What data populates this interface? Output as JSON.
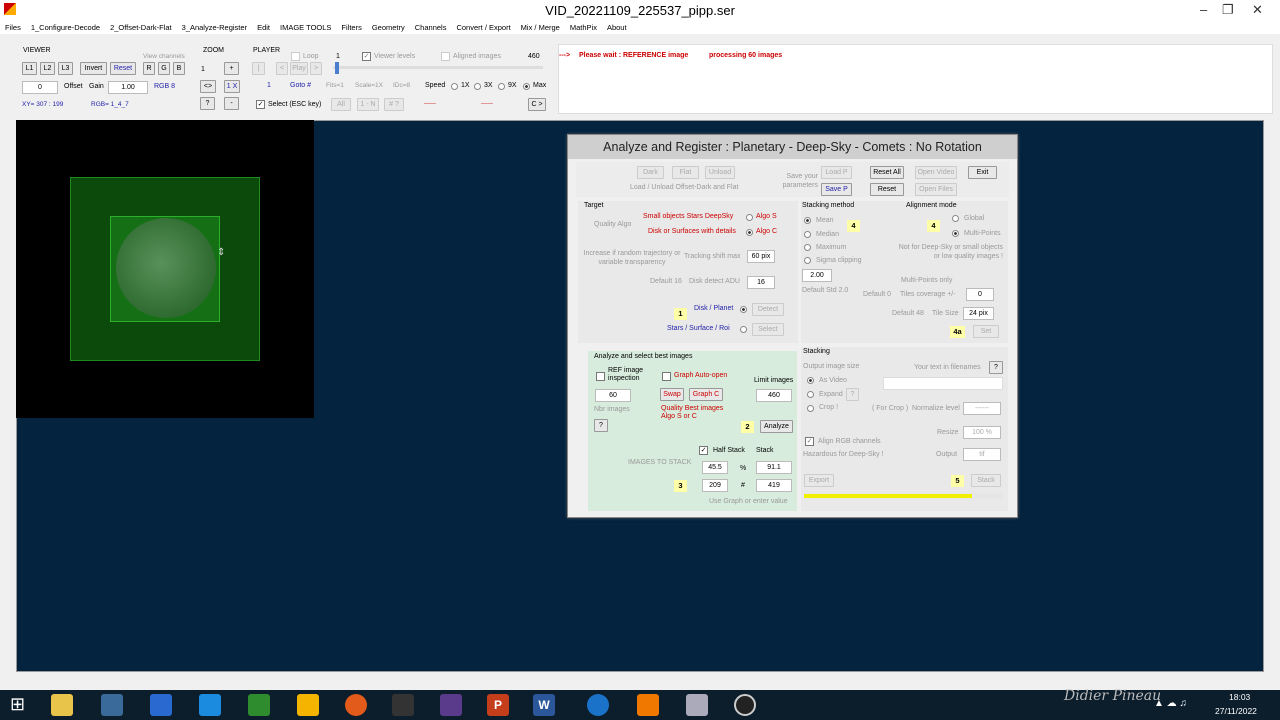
{
  "window": {
    "title": "VID_20221109_225537_pipp.ser"
  },
  "menu": [
    "Files",
    "1_Configure-Decode",
    "2_Offset-Dark-Flat",
    "3_Analyze-Register",
    "Edit",
    "IMAGE TOOLS",
    "Filters",
    "Geometry",
    "Channels",
    "Convert / Export",
    "Mix / Merge",
    "MathPix",
    "About"
  ],
  "viewer": {
    "label": "VIEWER",
    "view_channels": "View channels",
    "l1": "L1",
    "l2": "L2",
    "l3": "L3",
    "invert": "Invert",
    "reset": "Reset",
    "r": "R",
    "g": "G",
    "b": "B",
    "offset_value": "0",
    "offset": "Offset",
    "gain": "Gain",
    "gain_value": "1.00",
    "rgb": "RGB 8",
    "xy": "XY= 307 : 199",
    "rgbv": "RGB= 1_4_7"
  },
  "zoom": {
    "label": "ZOOM",
    "value": "1",
    "plus": "+",
    "swap": "<>",
    "one": "1 X",
    "q": "?",
    "minus": "-"
  },
  "player": {
    "label": "PLAYER",
    "loop": "Loop",
    "loop_val": "1",
    "viewer_levels": "Viewer levels",
    "aligned": "Aligned images",
    "count": "460",
    "play": "Play",
    "frame": "1",
    "goto": "Goto #",
    "fits": "Fits=1",
    "scale": "Scale=1X",
    "idc": "IDc=8",
    "speed": "Speed",
    "s1": "1X",
    "s3": "3X",
    "s9": "9X",
    "max": "Max",
    "select": "Select (ESC key)",
    "all": "All",
    "in": "1 - N",
    "hash": "# ?",
    "next": "C >",
    "dashes1": "------",
    "dashes2": "------"
  },
  "message": {
    "prefix": "--->",
    "text": "Please wait :  REFERENCE image",
    "proc": "processing 60 images"
  },
  "panel": {
    "title": "Analyze and Register :    Planetary - Deep-Sky - Comets  :   No Rotation",
    "dark": "Dark",
    "flat": "Flat",
    "unload": "Unload",
    "load_text": "Load / Unload Offset-Dark and Flat",
    "save_params": "Save your parameters",
    "loadp": "Load P",
    "savep": "Save P",
    "resetall": "Reset All",
    "reset": "Reset",
    "openvideo": "Open Video",
    "openfiles": "Open Files",
    "exit": "Exit",
    "target": "Target",
    "quality": "Quality Algo",
    "small": "Small objects  Stars  DeepSky",
    "algos": "Algo S",
    "disk": "Disk or Surfaces with details",
    "algoc": "Algo C",
    "increase": "Increase if random trajectory or variable transparency",
    "tracking": "Tracking shift max",
    "tracking_val": "60 pix",
    "default16": "Default 16",
    "diskdetect": "Disk detect ADU",
    "diskdetect_val": "16",
    "b1": "1",
    "diskplanet": "Disk / Planet",
    "detect": "Detect",
    "stars": "Stars / Surface / Roi",
    "select": "Select",
    "stacking_method": "Stacking method",
    "mean": "Mean",
    "median": "Median",
    "maximum": "Maximum",
    "sigma": "Sigma clipping",
    "sigma_val": "2.00",
    "default_std": "Default Std 2.0",
    "b4": "4",
    "alignment": "Alignment mode",
    "global": "Global",
    "multipoints": "Multi-Points",
    "b4b": "4",
    "not_for": "Not for Deep-Sky or small objects or low quality images !",
    "mp_only": "Multi-Points only",
    "default0": "Default 0",
    "tiles_cov": "Tiles coverage +/-",
    "tiles_val": "0",
    "default48": "Default 48",
    "tilesize": "Tile Size",
    "tilesize_val": "24 pix",
    "b4a": "4a",
    "set": "Set",
    "analyze_title": "Analyze and select best images",
    "ref": "REF image inspection",
    "graph_auto": "Graph Auto-open",
    "limit": "Limit images",
    "limit_val": "460",
    "n60": "60",
    "swap": "Swap",
    "graphc": "Graph C",
    "nbr": "Nbr images",
    "quality_best": "Quality Best images",
    "algosc": "Algo S or C",
    "q": "?",
    "b2": "2",
    "analyze": "Analyze",
    "halfstack": "Half Stack",
    "stack": "Stack",
    "images_to_stack": "IMAGES TO STACK",
    "pct1": "45.5",
    "pct": "%",
    "pct2": "91.1",
    "b3": "3",
    "n1": "209",
    "hash": "#",
    "n2": "419",
    "use_graph": "Use Graph or enter value",
    "stacking": "Stacking",
    "output_size": "Output  image size",
    "as_video": "As Video",
    "expand": "Expand",
    "crop": "Crop !",
    "q2": "?",
    "your_text": "Your text in filenames",
    "q3": "?",
    "for_crop": "( For Crop )",
    "normalize": "Normalize level",
    "norm_val": "------",
    "resize": "Resize",
    "resize_val": "100 %",
    "align_rgb": "Align RGB channels",
    "hazard": "Hazardous for Deep-Sky !",
    "output": "Output",
    "output_val": "tif",
    "export": "Export",
    "b5": "5",
    "stackbtn": "Stack"
  },
  "taskbar": {
    "time": "18:03",
    "date": "27/11/2022",
    "watermark": "Didier Pineau"
  },
  "colors": {
    "accent_red": "#cc0000",
    "accent_blue": "#2222aa",
    "progress": "#f0f000"
  }
}
